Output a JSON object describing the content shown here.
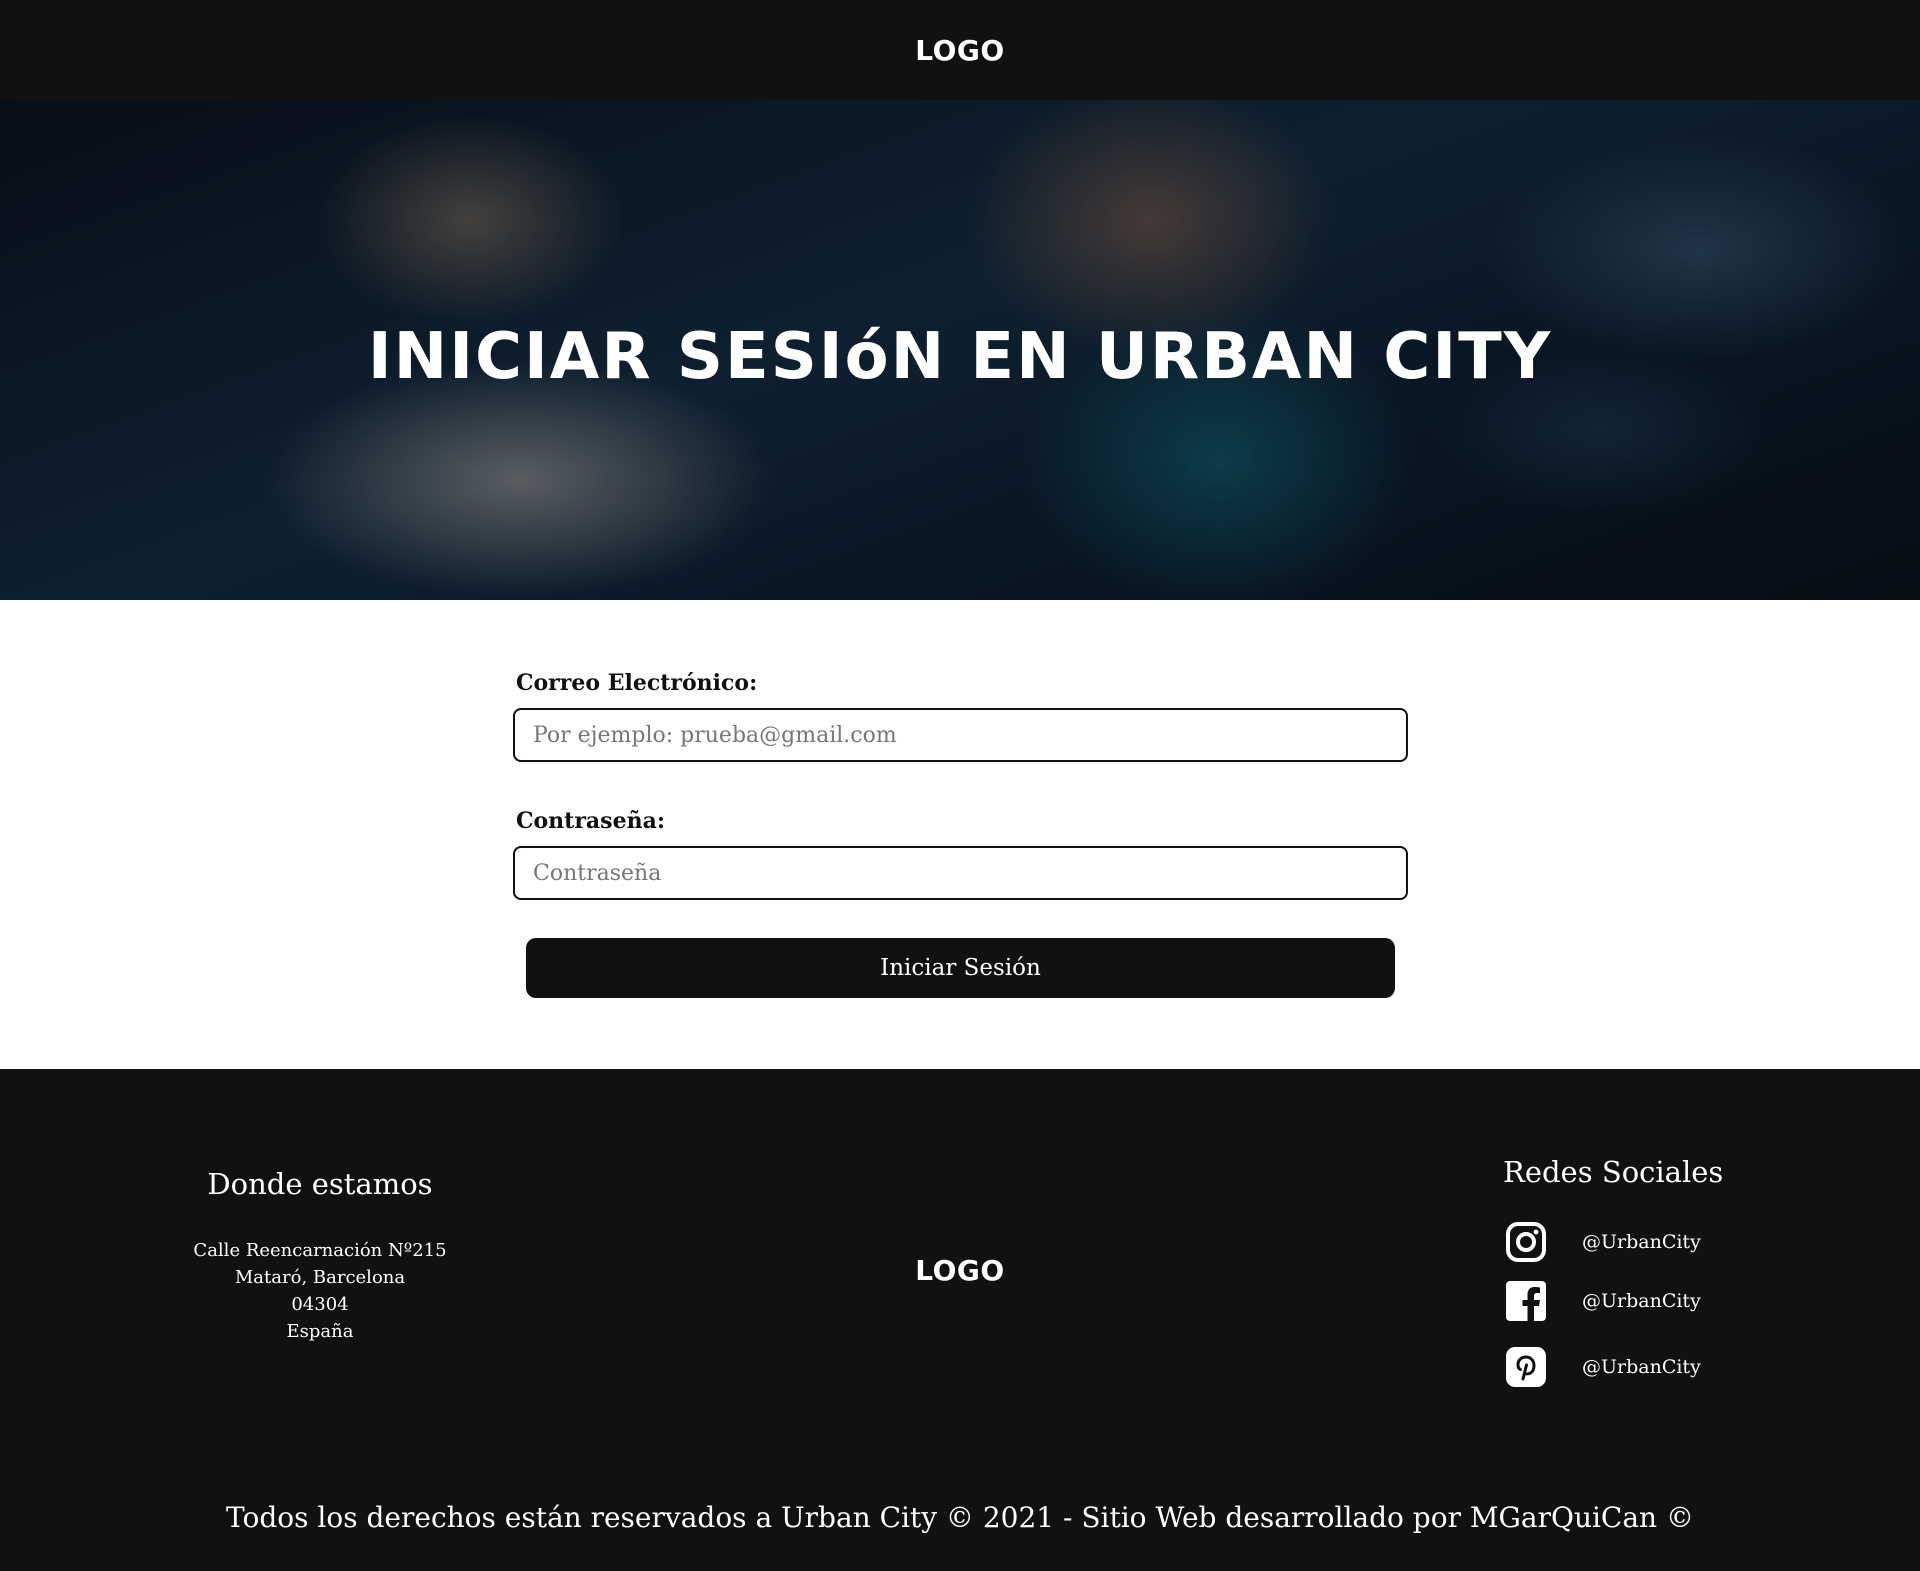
{
  "header": {
    "logo": "LOGO"
  },
  "hero": {
    "title": "INICIAR SESIóN EN URBAN CITY"
  },
  "form": {
    "email_label": "Correo Electrónico:",
    "email_placeholder": "Por ejemplo: prueba@gmail.com",
    "password_label": "Contraseña:",
    "password_placeholder": "Contraseña",
    "submit_label": "Iniciar Sesión"
  },
  "footer": {
    "location_heading": "Donde estamos",
    "address": [
      "Calle Reencarnación Nº215",
      "Mataró, Barcelona",
      "04304",
      "España"
    ],
    "logo": "LOGO",
    "social_heading": "Redes Sociales",
    "social": [
      {
        "icon": "instagram-icon",
        "handle": "@UrbanCity"
      },
      {
        "icon": "facebook-icon",
        "handle": "@UrbanCity"
      },
      {
        "icon": "pinterest-icon",
        "handle": "@UrbanCity"
      }
    ],
    "copyright": "Todos los derechos están reservados a Urban City © 2021  - Sitio Web desarrollado por MGarQuiCan ©"
  },
  "colors": {
    "dark": "#111111",
    "white": "#ffffff"
  }
}
